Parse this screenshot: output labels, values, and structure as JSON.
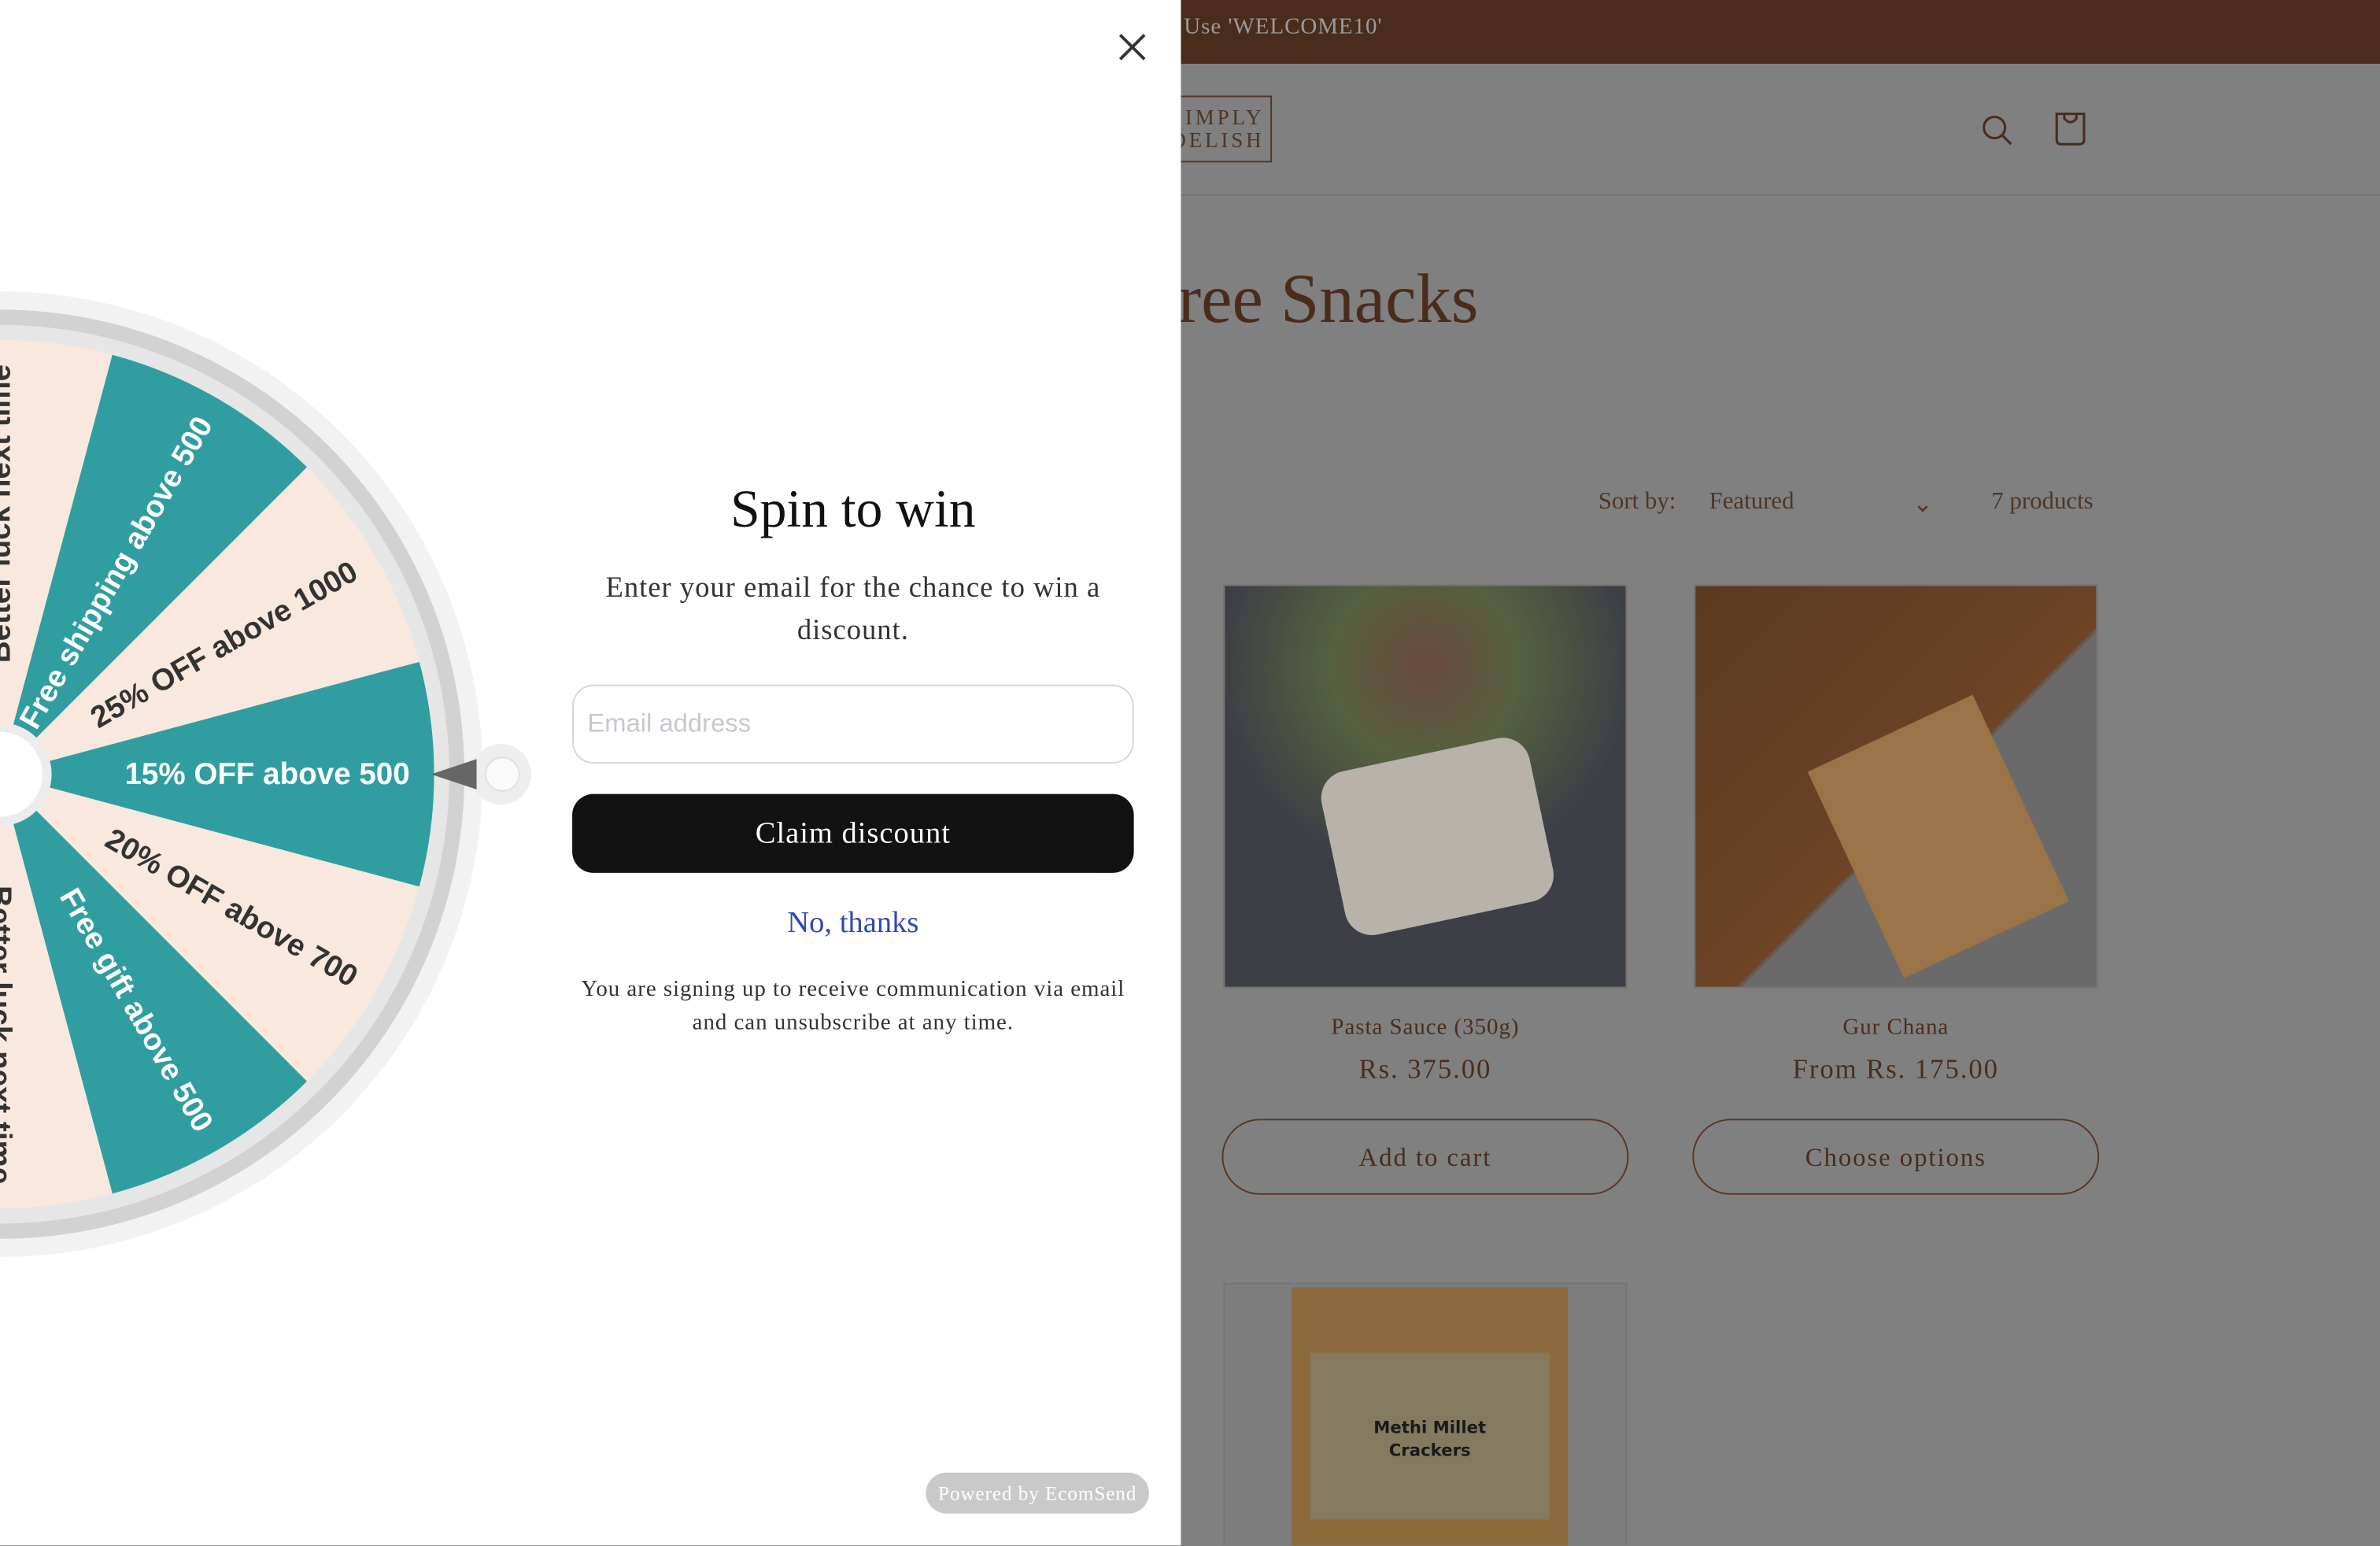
{
  "store": {
    "banner_text": "Use 'WELCOME10'",
    "logo_line1": "SIMPLY",
    "logo_line2": "DELISH",
    "collection_title": "ree Snacks",
    "sort_label": "Sort by:",
    "sort_value": "Featured",
    "product_count": "7 products",
    "products": [
      {
        "name": "Pasta Sauce (350g)",
        "price": "Rs. 375.00",
        "button": "Add to cart"
      },
      {
        "name": "Gur Chana",
        "price": "From Rs. 175.00",
        "button": "Choose options"
      },
      {
        "name": "Methi Millet Crackers"
      }
    ],
    "colors": {
      "banner": "#4a2c1d",
      "text": "#4a2c1d",
      "overlay": "#808080"
    }
  },
  "popup": {
    "title": "Spin to win",
    "subtitle": "Enter your email for the chance to win a discount.",
    "email_placeholder": "Email address",
    "email_value": "",
    "claim_button": "Claim discount",
    "decline_link": "No, thanks",
    "legal": "You are signing up to receive communication via email and can unsubscribe at any time.",
    "powered_by": "Powered by EcomSend",
    "wheel": {
      "segments": [
        {
          "label": "Better luck next time",
          "color": "#f8e8de",
          "text_color": "#333333"
        },
        {
          "label": "Free shipping above 500",
          "color": "#309ea0",
          "text_color": "#ffffff"
        },
        {
          "label": "25% OFF above 1000",
          "color": "#f8e8de",
          "text_color": "#333333"
        },
        {
          "label": "15% OFF above 500",
          "color": "#309ea0",
          "text_color": "#ffffff"
        },
        {
          "label": "20% OFF above 700",
          "color": "#f8e8de",
          "text_color": "#333333"
        },
        {
          "label": "Free gift above 500",
          "color": "#309ea0",
          "text_color": "#ffffff"
        },
        {
          "label": "Better luck next time",
          "color": "#f8e8de",
          "text_color": "#333333"
        }
      ]
    }
  }
}
